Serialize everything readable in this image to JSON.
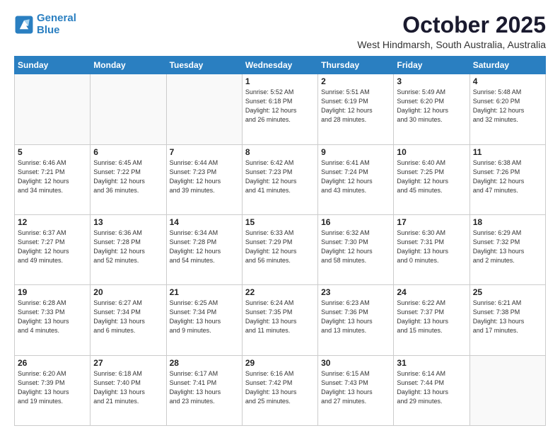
{
  "header": {
    "logo_line1": "General",
    "logo_line2": "Blue",
    "month": "October 2025",
    "location": "West Hindmarsh, South Australia, Australia"
  },
  "days_of_week": [
    "Sunday",
    "Monday",
    "Tuesday",
    "Wednesday",
    "Thursday",
    "Friday",
    "Saturday"
  ],
  "weeks": [
    [
      {
        "day": "",
        "info": ""
      },
      {
        "day": "",
        "info": ""
      },
      {
        "day": "",
        "info": ""
      },
      {
        "day": "1",
        "info": "Sunrise: 5:52 AM\nSunset: 6:18 PM\nDaylight: 12 hours\nand 26 minutes."
      },
      {
        "day": "2",
        "info": "Sunrise: 5:51 AM\nSunset: 6:19 PM\nDaylight: 12 hours\nand 28 minutes."
      },
      {
        "day": "3",
        "info": "Sunrise: 5:49 AM\nSunset: 6:20 PM\nDaylight: 12 hours\nand 30 minutes."
      },
      {
        "day": "4",
        "info": "Sunrise: 5:48 AM\nSunset: 6:20 PM\nDaylight: 12 hours\nand 32 minutes."
      }
    ],
    [
      {
        "day": "5",
        "info": "Sunrise: 6:46 AM\nSunset: 7:21 PM\nDaylight: 12 hours\nand 34 minutes."
      },
      {
        "day": "6",
        "info": "Sunrise: 6:45 AM\nSunset: 7:22 PM\nDaylight: 12 hours\nand 36 minutes."
      },
      {
        "day": "7",
        "info": "Sunrise: 6:44 AM\nSunset: 7:23 PM\nDaylight: 12 hours\nand 39 minutes."
      },
      {
        "day": "8",
        "info": "Sunrise: 6:42 AM\nSunset: 7:23 PM\nDaylight: 12 hours\nand 41 minutes."
      },
      {
        "day": "9",
        "info": "Sunrise: 6:41 AM\nSunset: 7:24 PM\nDaylight: 12 hours\nand 43 minutes."
      },
      {
        "day": "10",
        "info": "Sunrise: 6:40 AM\nSunset: 7:25 PM\nDaylight: 12 hours\nand 45 minutes."
      },
      {
        "day": "11",
        "info": "Sunrise: 6:38 AM\nSunset: 7:26 PM\nDaylight: 12 hours\nand 47 minutes."
      }
    ],
    [
      {
        "day": "12",
        "info": "Sunrise: 6:37 AM\nSunset: 7:27 PM\nDaylight: 12 hours\nand 49 minutes."
      },
      {
        "day": "13",
        "info": "Sunrise: 6:36 AM\nSunset: 7:28 PM\nDaylight: 12 hours\nand 52 minutes."
      },
      {
        "day": "14",
        "info": "Sunrise: 6:34 AM\nSunset: 7:28 PM\nDaylight: 12 hours\nand 54 minutes."
      },
      {
        "day": "15",
        "info": "Sunrise: 6:33 AM\nSunset: 7:29 PM\nDaylight: 12 hours\nand 56 minutes."
      },
      {
        "day": "16",
        "info": "Sunrise: 6:32 AM\nSunset: 7:30 PM\nDaylight: 12 hours\nand 58 minutes."
      },
      {
        "day": "17",
        "info": "Sunrise: 6:30 AM\nSunset: 7:31 PM\nDaylight: 13 hours\nand 0 minutes."
      },
      {
        "day": "18",
        "info": "Sunrise: 6:29 AM\nSunset: 7:32 PM\nDaylight: 13 hours\nand 2 minutes."
      }
    ],
    [
      {
        "day": "19",
        "info": "Sunrise: 6:28 AM\nSunset: 7:33 PM\nDaylight: 13 hours\nand 4 minutes."
      },
      {
        "day": "20",
        "info": "Sunrise: 6:27 AM\nSunset: 7:34 PM\nDaylight: 13 hours\nand 6 minutes."
      },
      {
        "day": "21",
        "info": "Sunrise: 6:25 AM\nSunset: 7:34 PM\nDaylight: 13 hours\nand 9 minutes."
      },
      {
        "day": "22",
        "info": "Sunrise: 6:24 AM\nSunset: 7:35 PM\nDaylight: 13 hours\nand 11 minutes."
      },
      {
        "day": "23",
        "info": "Sunrise: 6:23 AM\nSunset: 7:36 PM\nDaylight: 13 hours\nand 13 minutes."
      },
      {
        "day": "24",
        "info": "Sunrise: 6:22 AM\nSunset: 7:37 PM\nDaylight: 13 hours\nand 15 minutes."
      },
      {
        "day": "25",
        "info": "Sunrise: 6:21 AM\nSunset: 7:38 PM\nDaylight: 13 hours\nand 17 minutes."
      }
    ],
    [
      {
        "day": "26",
        "info": "Sunrise: 6:20 AM\nSunset: 7:39 PM\nDaylight: 13 hours\nand 19 minutes."
      },
      {
        "day": "27",
        "info": "Sunrise: 6:18 AM\nSunset: 7:40 PM\nDaylight: 13 hours\nand 21 minutes."
      },
      {
        "day": "28",
        "info": "Sunrise: 6:17 AM\nSunset: 7:41 PM\nDaylight: 13 hours\nand 23 minutes."
      },
      {
        "day": "29",
        "info": "Sunrise: 6:16 AM\nSunset: 7:42 PM\nDaylight: 13 hours\nand 25 minutes."
      },
      {
        "day": "30",
        "info": "Sunrise: 6:15 AM\nSunset: 7:43 PM\nDaylight: 13 hours\nand 27 minutes."
      },
      {
        "day": "31",
        "info": "Sunrise: 6:14 AM\nSunset: 7:44 PM\nDaylight: 13 hours\nand 29 minutes."
      },
      {
        "day": "",
        "info": ""
      }
    ]
  ]
}
